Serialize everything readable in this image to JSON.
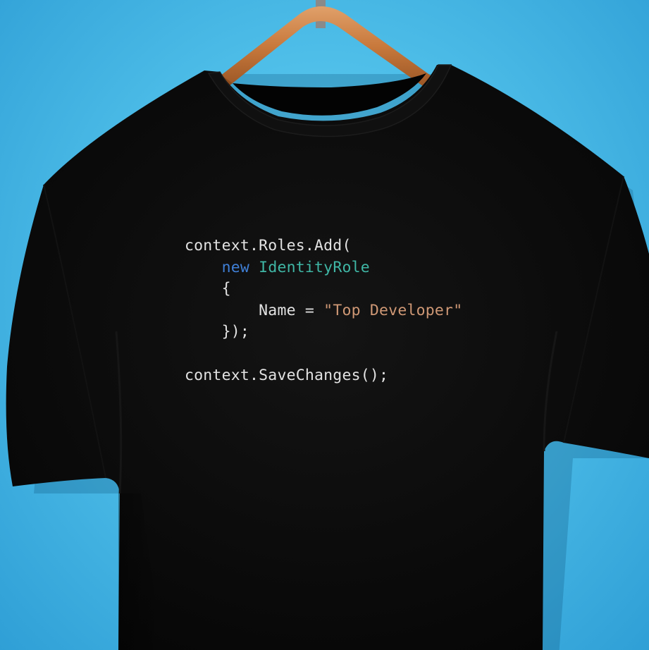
{
  "colors": {
    "background": "#4fbfe9",
    "shirt": "#0a0a0a",
    "hanger": "#c8793c",
    "code_default": "#e2e2e2",
    "code_keyword": "#3f7fd6",
    "code_type": "#3fb6a5",
    "code_string": "#cf9875"
  },
  "code": {
    "line1": "context.Roles.Add(",
    "line2_keyword": "new",
    "line2_type": "IdentityRole",
    "line3": "{",
    "line4_name": "Name = ",
    "line4_string": "\"Top Developer\"",
    "line5": "});",
    "line7": "context.SaveChanges();"
  }
}
